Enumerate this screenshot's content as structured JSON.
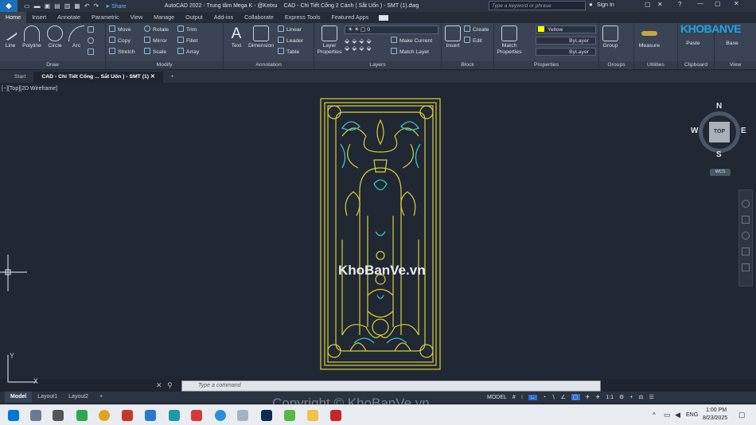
{
  "titlebar": {
    "app_title": "AutoCAD 2022 - Trung tâm Mega K - @Ketxu",
    "doc_title": "CAD - Chi Tiết Cổng 2 Cánh ( Sắt Uốn ) - SMT (1).dwg",
    "share_label": "Share",
    "search_placeholder": "Type a keyword or phrase",
    "sign_in": "Sign In"
  },
  "ribbon_tabs": [
    "Home",
    "Insert",
    "Annotate",
    "Parametric",
    "View",
    "Manage",
    "Output",
    "Add-ins",
    "Collaborate",
    "Express Tools",
    "Featured Apps"
  ],
  "draw_panel": {
    "title": "Draw",
    "line": "Line",
    "polyline": "Polyline",
    "circle": "Circle",
    "arc": "Arc"
  },
  "modify_panel": {
    "title": "Modify",
    "move": "Move",
    "rotate": "Rotate",
    "trim": "Trim",
    "copy": "Copy",
    "mirror": "Mirror",
    "fillet": "Fillet",
    "stretch": "Stretch",
    "scale": "Scale",
    "array": "Array"
  },
  "annotation_panel": {
    "title": "Annotation",
    "text": "Text",
    "dimension": "Dimension",
    "linear": "Linear",
    "leader": "Leader",
    "table": "Table"
  },
  "layers_panel": {
    "title": "Layers",
    "layer_properties": "Layer Properties",
    "layer_name": "0",
    "make_current": "Make Current",
    "match_layer": "Match Layer"
  },
  "block_panel": {
    "title": "Block",
    "insert": "Insert",
    "create": "Create",
    "edit": "Edit"
  },
  "properties_panel": {
    "title": "Properties",
    "match_properties": "Match Properties",
    "color": "Yellow",
    "color_hex": "#ffff00",
    "linetype": "ByLayer",
    "lineweight": "ByLayer"
  },
  "groups_panel": {
    "title": "Groups",
    "group": "Group"
  },
  "utilities_panel": {
    "title": "Utilities",
    "measure": "Measure"
  },
  "clipboard_panel": {
    "title": "Clipboard",
    "paste": "Paste"
  },
  "view_panel": {
    "title": "View",
    "base": "Base"
  },
  "file_tabs": {
    "start": "Start",
    "active": "CAD - Chi Tiết Cổng ... Sắt Uốn ) - SMT (1)"
  },
  "viewport": {
    "label": "[−][Top][2D Wireframe]",
    "watermark": "KhoBanVe.vn"
  },
  "viewcube": {
    "n": "N",
    "s": "S",
    "e": "E",
    "w": "W",
    "face": "TOP",
    "wcs": "WCS"
  },
  "command": {
    "placeholder": "Type a command"
  },
  "layout_tabs": [
    "Model",
    "Layout1",
    "Layout2"
  ],
  "status": {
    "model": "MODEL",
    "scale": "1:1"
  },
  "copyright": "Copyright © KhoBanVe.vn",
  "logo_text": "KHOBANVE",
  "taskbar": {
    "lang": "ENG",
    "time": "1:00 PM",
    "date": "8/23/2025"
  },
  "colors": {
    "drawing_yellow": "#d7d13a",
    "drawing_cyan": "#35c7c9",
    "canvas": "#212733",
    "ribbon": "#3a4454"
  }
}
